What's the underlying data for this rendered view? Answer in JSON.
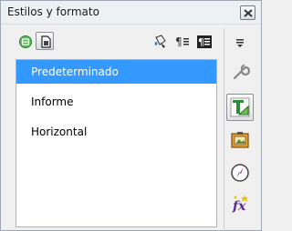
{
  "window": {
    "title": "Estilos y formato"
  },
  "toolbar": {
    "icons": [
      "paragraph-styles-icon",
      "page-styles-icon",
      "fill-format-icon",
      "new-style-icon",
      "update-style-icon"
    ]
  },
  "styles_list": {
    "items": [
      {
        "label": "Predeterminado",
        "selected": true
      },
      {
        "label": "Informe",
        "selected": false
      },
      {
        "label": "Horizontal",
        "selected": false
      }
    ]
  },
  "sidebar": {
    "icons": [
      "menu-icon",
      "properties-wrench-icon",
      "styles-and-formatting-icon",
      "gallery-icon",
      "navigator-icon",
      "functions-icon"
    ],
    "active": "styles-and-formatting-icon"
  },
  "colors": {
    "selection": "#3399ff",
    "list_bg": "#ffffff",
    "panel_bg": "#f0f0f0"
  }
}
